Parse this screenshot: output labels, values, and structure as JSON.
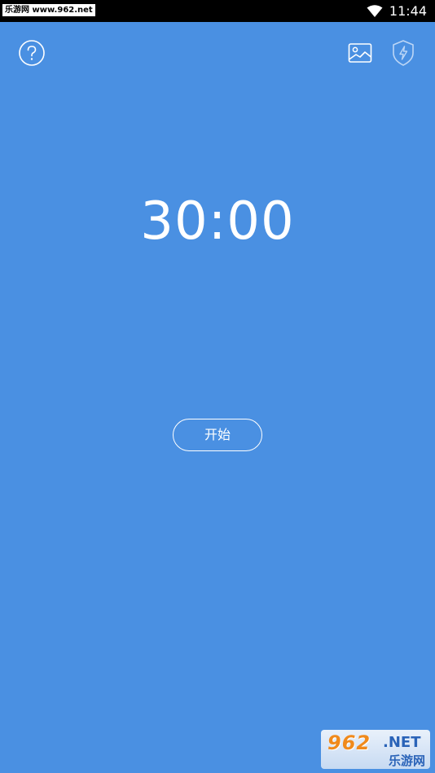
{
  "status_bar": {
    "watermark": "乐游网 www.962.net",
    "time": "11:44",
    "wifi_icon": "wifi-icon"
  },
  "toolbar": {
    "help_icon": "help-icon",
    "image_icon": "image-icon",
    "shield_icon": "shield-bolt-icon"
  },
  "timer": {
    "display": "30:00"
  },
  "controls": {
    "start_label": "开始"
  },
  "watermark": {
    "brand_number": "962",
    "brand_suffix": ".NET",
    "brand_cn": "乐游网"
  },
  "colors": {
    "background": "#4a90e2",
    "foreground": "#ffffff",
    "status_bar": "#000000"
  }
}
